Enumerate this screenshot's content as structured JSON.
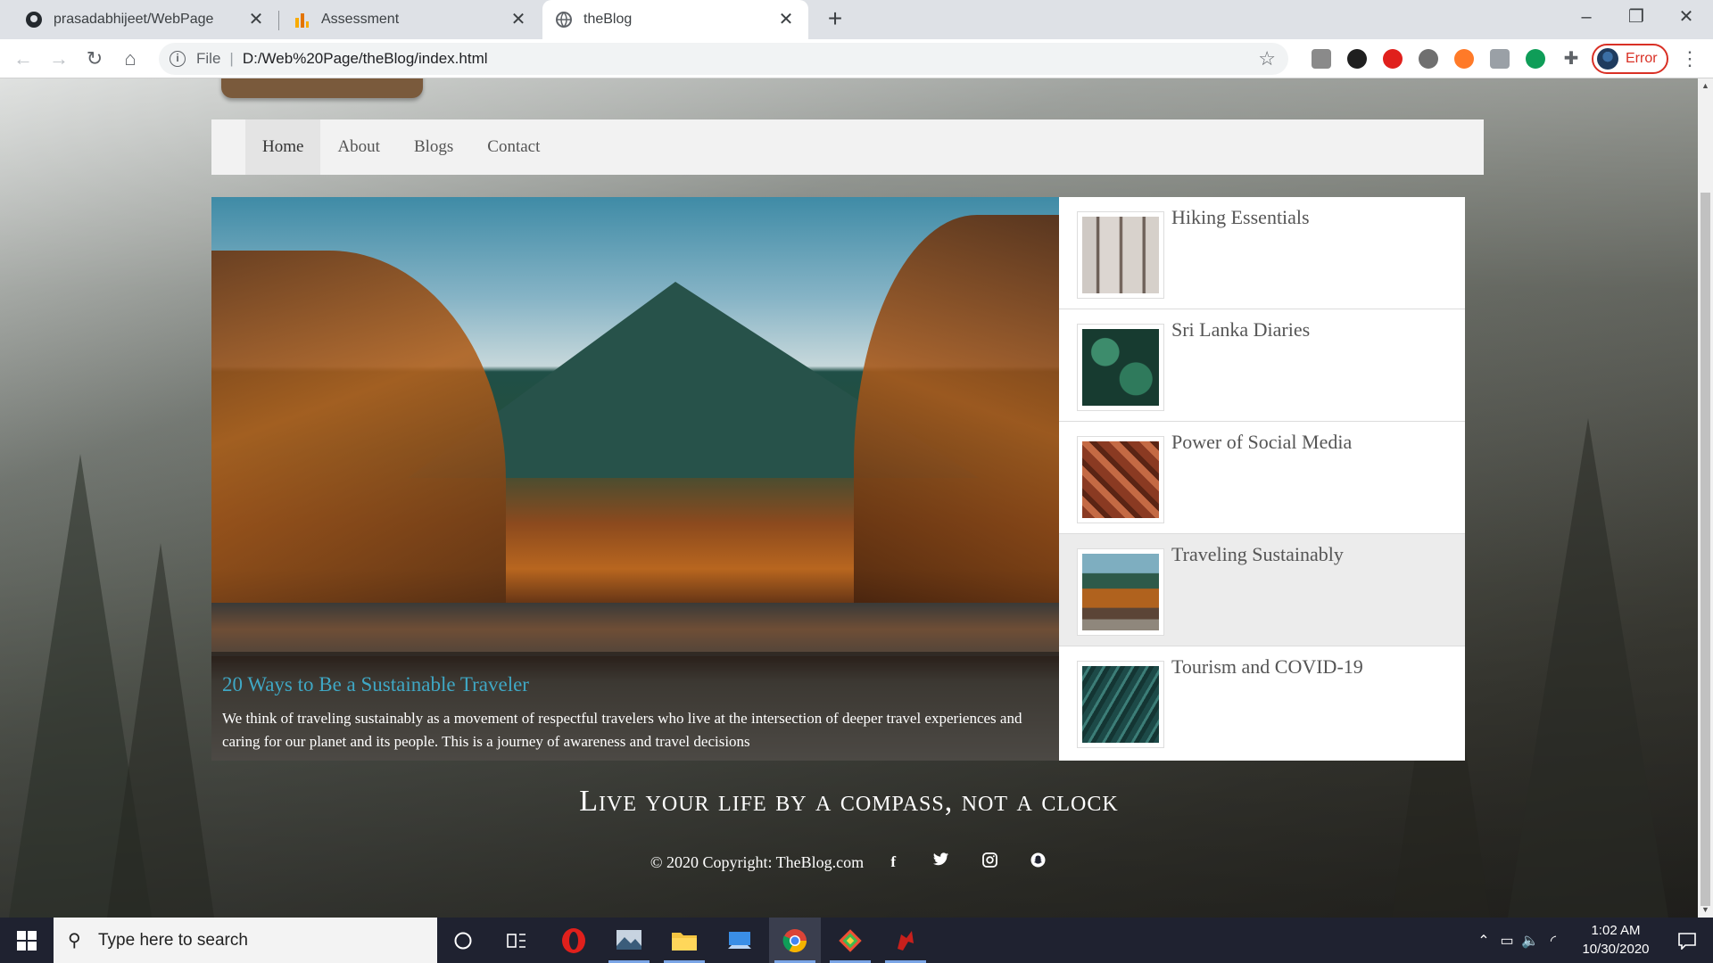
{
  "browser": {
    "tabs": [
      {
        "title": "prasadabhijeet/WebPage",
        "icon": "github-icon"
      },
      {
        "title": "Assessment",
        "icon": "analytics-icon"
      },
      {
        "title": "theBlog",
        "icon": "globe-icon",
        "active": true
      }
    ],
    "address": {
      "scheme": "File",
      "url": "D:/Web%20Page/theBlog/index.html"
    },
    "profile_label": "Error"
  },
  "site": {
    "nav": [
      "Home",
      "About",
      "Blogs",
      "Contact"
    ],
    "active_nav": "Home",
    "featured": {
      "title": "20 Ways to Be a Sustainable Traveler",
      "text": "We think of traveling sustainably as a movement of respectful travelers who live at the intersection of deeper travel experiences and caring for our planet and its people. This is a journey of awareness and travel decisions"
    },
    "posts": [
      {
        "title": "Hiking Essentials",
        "thumb": "misty-forest"
      },
      {
        "title": "Sri Lanka Diaries",
        "thumb": "green-leaves"
      },
      {
        "title": "Power of Social Media",
        "thumb": "autumn-leaves"
      },
      {
        "title": "Traveling Sustainably",
        "thumb": "autumn-mountain"
      },
      {
        "title": "Tourism and COVID-19",
        "thumb": "fern"
      }
    ],
    "quote": "Live your life by a compass, not a clock",
    "footer": {
      "copyright": "© 2020 Copyright: TheBlog.com",
      "social": [
        "facebook-icon",
        "twitter-icon",
        "instagram-icon",
        "snapchat-icon"
      ]
    }
  },
  "taskbar": {
    "search_placeholder": "Type here to search",
    "time": "1:02 AM",
    "date": "10/30/2020"
  }
}
